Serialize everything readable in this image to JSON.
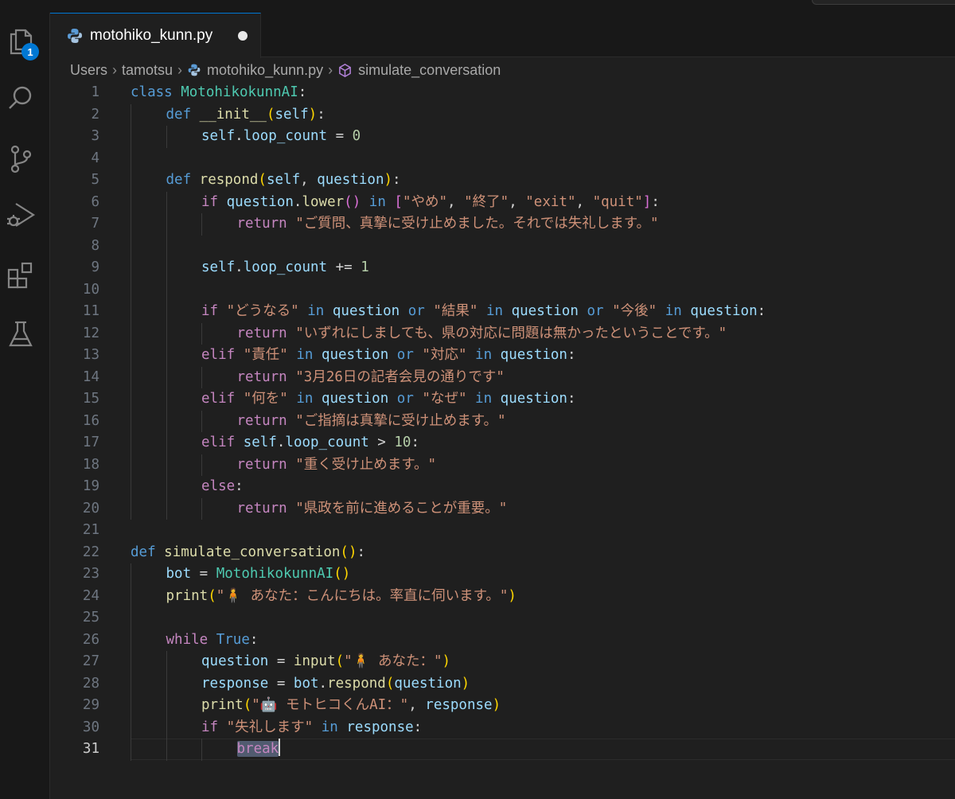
{
  "window": {
    "tab": {
      "filename": "motohiko_kunn.py",
      "modified": true
    }
  },
  "activity_bar": {
    "explorer_badge": "1"
  },
  "breadcrumb": {
    "items": [
      "Users",
      "tamotsu",
      "motohiko_kunn.py",
      "simulate_conversation"
    ]
  },
  "editor": {
    "active_line": 31,
    "lines": [
      {
        "n": "1",
        "indent": 0,
        "t": [
          [
            "k",
            "class"
          ],
          [
            "p",
            " "
          ],
          [
            "cls",
            "MotohikokunnAI"
          ],
          [
            "p",
            ":"
          ]
        ]
      },
      {
        "n": "2",
        "indent": 1,
        "t": [
          [
            "k",
            "def"
          ],
          [
            "p",
            " "
          ],
          [
            "fn",
            "__init__"
          ],
          [
            "b1",
            "("
          ],
          [
            "v",
            "self"
          ],
          [
            "b1",
            ")"
          ],
          [
            "p",
            ":"
          ]
        ]
      },
      {
        "n": "3",
        "indent": 2,
        "t": [
          [
            "v",
            "self"
          ],
          [
            "p",
            "."
          ],
          [
            "v",
            "loop_count"
          ],
          [
            "p",
            " = "
          ],
          [
            "n",
            "0"
          ]
        ]
      },
      {
        "n": "4",
        "indent": 0,
        "t": []
      },
      {
        "n": "5",
        "indent": 1,
        "t": [
          [
            "k",
            "def"
          ],
          [
            "p",
            " "
          ],
          [
            "fn",
            "respond"
          ],
          [
            "b1",
            "("
          ],
          [
            "v",
            "self"
          ],
          [
            "p",
            ", "
          ],
          [
            "v",
            "question"
          ],
          [
            "b1",
            ")"
          ],
          [
            "p",
            ":"
          ]
        ]
      },
      {
        "n": "6",
        "indent": 2,
        "t": [
          [
            "kc",
            "if"
          ],
          [
            "p",
            " "
          ],
          [
            "v",
            "question"
          ],
          [
            "p",
            "."
          ],
          [
            "fn",
            "lower"
          ],
          [
            "b2",
            "()"
          ],
          [
            "p",
            " "
          ],
          [
            "k",
            "in"
          ],
          [
            "p",
            " "
          ],
          [
            "b2",
            "["
          ],
          [
            "s",
            "\"やめ\""
          ],
          [
            "p",
            ", "
          ],
          [
            "s",
            "\"終了\""
          ],
          [
            "p",
            ", "
          ],
          [
            "s",
            "\"exit\""
          ],
          [
            "p",
            ", "
          ],
          [
            "s",
            "\"quit\""
          ],
          [
            "b2",
            "]"
          ],
          [
            "p",
            ":"
          ]
        ]
      },
      {
        "n": "7",
        "indent": 3,
        "t": [
          [
            "kc",
            "return"
          ],
          [
            "p",
            " "
          ],
          [
            "s",
            "\"ご質問、真摯に受け止めました。それでは失礼します。\""
          ]
        ]
      },
      {
        "n": "8",
        "indent": 0,
        "t": []
      },
      {
        "n": "9",
        "indent": 2,
        "t": [
          [
            "v",
            "self"
          ],
          [
            "p",
            "."
          ],
          [
            "v",
            "loop_count"
          ],
          [
            "p",
            " += "
          ],
          [
            "n",
            "1"
          ]
        ]
      },
      {
        "n": "10",
        "indent": 0,
        "t": []
      },
      {
        "n": "11",
        "indent": 2,
        "t": [
          [
            "kc",
            "if"
          ],
          [
            "p",
            " "
          ],
          [
            "s",
            "\"どうなる\""
          ],
          [
            "p",
            " "
          ],
          [
            "k",
            "in"
          ],
          [
            "p",
            " "
          ],
          [
            "v",
            "question"
          ],
          [
            "p",
            " "
          ],
          [
            "k",
            "or"
          ],
          [
            "p",
            " "
          ],
          [
            "s",
            "\"結果\""
          ],
          [
            "p",
            " "
          ],
          [
            "k",
            "in"
          ],
          [
            "p",
            " "
          ],
          [
            "v",
            "question"
          ],
          [
            "p",
            " "
          ],
          [
            "k",
            "or"
          ],
          [
            "p",
            " "
          ],
          [
            "s",
            "\"今後\""
          ],
          [
            "p",
            " "
          ],
          [
            "k",
            "in"
          ],
          [
            "p",
            " "
          ],
          [
            "v",
            "question"
          ],
          [
            "p",
            ":"
          ]
        ]
      },
      {
        "n": "12",
        "indent": 3,
        "t": [
          [
            "kc",
            "return"
          ],
          [
            "p",
            " "
          ],
          [
            "s",
            "\"いずれにしましても、県の対応に問題は無かったということです。\""
          ]
        ]
      },
      {
        "n": "13",
        "indent": 2,
        "t": [
          [
            "kc",
            "elif"
          ],
          [
            "p",
            " "
          ],
          [
            "s",
            "\"責任\""
          ],
          [
            "p",
            " "
          ],
          [
            "k",
            "in"
          ],
          [
            "p",
            " "
          ],
          [
            "v",
            "question"
          ],
          [
            "p",
            " "
          ],
          [
            "k",
            "or"
          ],
          [
            "p",
            " "
          ],
          [
            "s",
            "\"対応\""
          ],
          [
            "p",
            " "
          ],
          [
            "k",
            "in"
          ],
          [
            "p",
            " "
          ],
          [
            "v",
            "question"
          ],
          [
            "p",
            ":"
          ]
        ]
      },
      {
        "n": "14",
        "indent": 3,
        "t": [
          [
            "kc",
            "return"
          ],
          [
            "p",
            " "
          ],
          [
            "s",
            "\"3月26日の記者会見の通りです\""
          ]
        ]
      },
      {
        "n": "15",
        "indent": 2,
        "t": [
          [
            "kc",
            "elif"
          ],
          [
            "p",
            " "
          ],
          [
            "s",
            "\"何を\""
          ],
          [
            "p",
            " "
          ],
          [
            "k",
            "in"
          ],
          [
            "p",
            " "
          ],
          [
            "v",
            "question"
          ],
          [
            "p",
            " "
          ],
          [
            "k",
            "or"
          ],
          [
            "p",
            " "
          ],
          [
            "s",
            "\"なぜ\""
          ],
          [
            "p",
            " "
          ],
          [
            "k",
            "in"
          ],
          [
            "p",
            " "
          ],
          [
            "v",
            "question"
          ],
          [
            "p",
            ":"
          ]
        ]
      },
      {
        "n": "16",
        "indent": 3,
        "t": [
          [
            "kc",
            "return"
          ],
          [
            "p",
            " "
          ],
          [
            "s",
            "\"ご指摘は真摯に受け止めます。\""
          ]
        ]
      },
      {
        "n": "17",
        "indent": 2,
        "t": [
          [
            "kc",
            "elif"
          ],
          [
            "p",
            " "
          ],
          [
            "v",
            "self"
          ],
          [
            "p",
            "."
          ],
          [
            "v",
            "loop_count"
          ],
          [
            "p",
            " > "
          ],
          [
            "n",
            "10"
          ],
          [
            "p",
            ":"
          ]
        ]
      },
      {
        "n": "18",
        "indent": 3,
        "t": [
          [
            "kc",
            "return"
          ],
          [
            "p",
            " "
          ],
          [
            "s",
            "\"重く受け止めます。\""
          ]
        ]
      },
      {
        "n": "19",
        "indent": 2,
        "t": [
          [
            "kc",
            "else"
          ],
          [
            "p",
            ":"
          ]
        ]
      },
      {
        "n": "20",
        "indent": 3,
        "t": [
          [
            "kc",
            "return"
          ],
          [
            "p",
            " "
          ],
          [
            "s",
            "\"県政を前に進めることが重要。\""
          ]
        ]
      },
      {
        "n": "21",
        "indent": 0,
        "t": []
      },
      {
        "n": "22",
        "indent": 0,
        "t": [
          [
            "k",
            "def"
          ],
          [
            "p",
            " "
          ],
          [
            "fn",
            "simulate_conversation"
          ],
          [
            "b1",
            "()"
          ],
          [
            "p",
            ":"
          ]
        ]
      },
      {
        "n": "23",
        "indent": 1,
        "t": [
          [
            "v",
            "bot"
          ],
          [
            "p",
            " = "
          ],
          [
            "cls",
            "MotohikokunnAI"
          ],
          [
            "b1",
            "()"
          ]
        ]
      },
      {
        "n": "24",
        "indent": 1,
        "t": [
          [
            "fn",
            "print"
          ],
          [
            "b1",
            "("
          ],
          [
            "s",
            "\"🧍 あなた：こんにちは。率直に伺います。\""
          ],
          [
            "b1",
            ")"
          ]
        ]
      },
      {
        "n": "25",
        "indent": 0,
        "t": []
      },
      {
        "n": "26",
        "indent": 1,
        "t": [
          [
            "kc",
            "while"
          ],
          [
            "p",
            " "
          ],
          [
            "k",
            "True"
          ],
          [
            "p",
            ":"
          ]
        ]
      },
      {
        "n": "27",
        "indent": 2,
        "t": [
          [
            "v",
            "question"
          ],
          [
            "p",
            " = "
          ],
          [
            "fn",
            "input"
          ],
          [
            "b1",
            "("
          ],
          [
            "s",
            "\"🧍 あなた：\""
          ],
          [
            "b1",
            ")"
          ]
        ]
      },
      {
        "n": "28",
        "indent": 2,
        "t": [
          [
            "v",
            "response"
          ],
          [
            "p",
            " = "
          ],
          [
            "v",
            "bot"
          ],
          [
            "p",
            "."
          ],
          [
            "fn",
            "respond"
          ],
          [
            "b1",
            "("
          ],
          [
            "v",
            "question"
          ],
          [
            "b1",
            ")"
          ]
        ]
      },
      {
        "n": "29",
        "indent": 2,
        "t": [
          [
            "fn",
            "print"
          ],
          [
            "b1",
            "("
          ],
          [
            "s",
            "\"🤖 モトヒコくんAI：\""
          ],
          [
            "p",
            ", "
          ],
          [
            "v",
            "response"
          ],
          [
            "b1",
            ")"
          ]
        ]
      },
      {
        "n": "30",
        "indent": 2,
        "t": [
          [
            "kc",
            "if"
          ],
          [
            "p",
            " "
          ],
          [
            "s",
            "\"失礼します\""
          ],
          [
            "p",
            " "
          ],
          [
            "k",
            "in"
          ],
          [
            "p",
            " "
          ],
          [
            "v",
            "response"
          ],
          [
            "p",
            ":"
          ]
        ]
      },
      {
        "n": "31",
        "indent": 3,
        "t": [
          [
            "kc hl",
            "break"
          ]
        ]
      }
    ]
  }
}
